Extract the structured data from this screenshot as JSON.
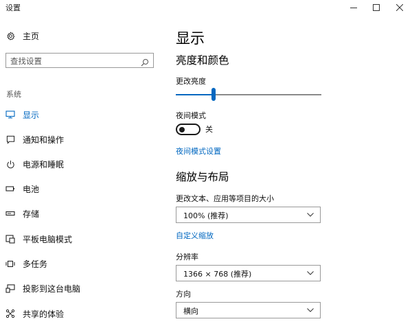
{
  "window": {
    "title": "设置",
    "controls": [
      "minimize-icon",
      "maximize-icon",
      "close-icon"
    ]
  },
  "sidebar": {
    "home": {
      "label": "主页",
      "icon": "gear-icon"
    },
    "search": {
      "placeholder": "查找设置",
      "icon": "search-icon"
    },
    "section_label": "系统",
    "items": [
      {
        "label": "显示",
        "icon": "monitor-icon",
        "active": true
      },
      {
        "label": "通知和操作",
        "icon": "notification-icon",
        "active": false
      },
      {
        "label": "电源和睡眠",
        "icon": "power-icon",
        "active": false
      },
      {
        "label": "电池",
        "icon": "battery-icon",
        "active": false
      },
      {
        "label": "存储",
        "icon": "storage-icon",
        "active": false
      },
      {
        "label": "平板电脑模式",
        "icon": "tablet-icon",
        "active": false
      },
      {
        "label": "多任务",
        "icon": "multitask-icon",
        "active": false
      },
      {
        "label": "投影到这台电脑",
        "icon": "project-icon",
        "active": false
      },
      {
        "label": "共享的体验",
        "icon": "shared-icon",
        "active": false
      }
    ]
  },
  "main": {
    "title": "显示",
    "brightness_section": {
      "heading": "亮度和颜色",
      "brightness_label": "更改亮度",
      "brightness_value": 0.26,
      "night_mode_label": "夜间模式",
      "night_mode_state": "关",
      "night_mode_on": false,
      "night_mode_link": "夜间模式设置"
    },
    "scale_section": {
      "heading": "缩放与布局",
      "scale_label": "更改文本、应用等项目的大小",
      "scale_value": "100% (推荐)",
      "custom_scale_link": "自定义缩放",
      "resolution_label": "分辨率",
      "resolution_value": "1366 × 768 (推荐)",
      "orientation_label": "方向",
      "orientation_value": "横向"
    }
  },
  "colors": {
    "accent": "#0067c0",
    "text": "#111111",
    "border": "#999999"
  }
}
